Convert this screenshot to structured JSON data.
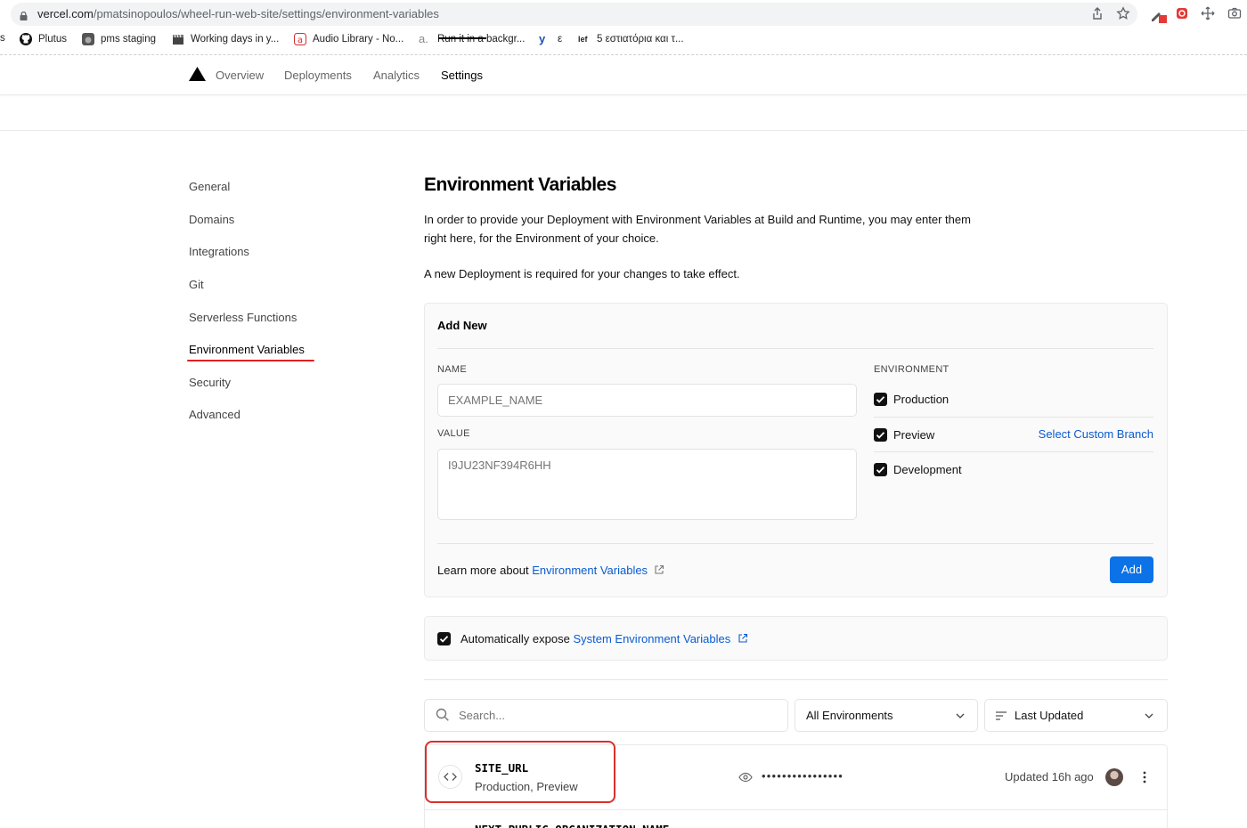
{
  "browser": {
    "url_host": "vercel.com",
    "url_path": "/pmatsinopoulos/wheel-run-web-site/settings/environment-variables",
    "bookmarks": [
      {
        "label": "s"
      },
      {
        "label": "Plutus",
        "icon": "github-icon"
      },
      {
        "label": "pms staging",
        "icon": "app-icon"
      },
      {
        "label": "Working days in y...",
        "icon": "clapper-icon"
      },
      {
        "label": "Audio Library - No...",
        "icon": "audio-library-icon"
      },
      {
        "label": "Run it in a backgr...",
        "icon": "letter-a-icon"
      },
      {
        "label": "ε",
        "icon": "yandex-icon"
      },
      {
        "label": "5 εστιατόρια και τ...",
        "icon": "lef-icon"
      }
    ]
  },
  "nav": {
    "tabs": [
      "Overview",
      "Deployments",
      "Analytics",
      "Settings"
    ],
    "active": "Settings"
  },
  "sidebar": {
    "items": [
      "General",
      "Domains",
      "Integrations",
      "Git",
      "Serverless Functions",
      "Environment Variables",
      "Security",
      "Advanced"
    ],
    "active": "Environment Variables"
  },
  "main": {
    "title": "Environment Variables",
    "intro": "In order to provide your Deployment with Environment Variables at Build and Runtime, you may enter them right here, for the Environment of your choice.",
    "note": "A new Deployment is required for your changes to take effect.",
    "add_new": {
      "heading": "Add New",
      "name_label": "NAME",
      "name_placeholder": "EXAMPLE_NAME",
      "value_label": "VALUE",
      "value_placeholder": "I9JU23NF394R6HH",
      "environment_label": "ENVIRONMENT",
      "environments": [
        {
          "label": "Production",
          "checked": true
        },
        {
          "label": "Preview",
          "checked": true
        },
        {
          "label": "Development",
          "checked": true
        }
      ],
      "custom_branch_link": "Select Custom Branch",
      "learn_prefix": "Learn more about ",
      "learn_link": "Environment Variables",
      "add_button": "Add"
    },
    "auto_expose": {
      "checked": true,
      "prefix": "Automatically expose ",
      "link": "System Environment Variables"
    },
    "filters": {
      "search_placeholder": "Search...",
      "environment_select": "All Environments",
      "sort_select": "Last Updated"
    },
    "variables": [
      {
        "name": "SITE_URL",
        "environments": "Production, Preview",
        "masked_value": "••••••••••••••••",
        "updated": "Updated 16h ago"
      },
      {
        "name": "NEXT_PUBLIC_ORGANIZATION_NAME"
      }
    ]
  },
  "colors": {
    "accent": "#0b72e7",
    "link": "#0a5bcf",
    "highlight_red": "#d9302a"
  }
}
